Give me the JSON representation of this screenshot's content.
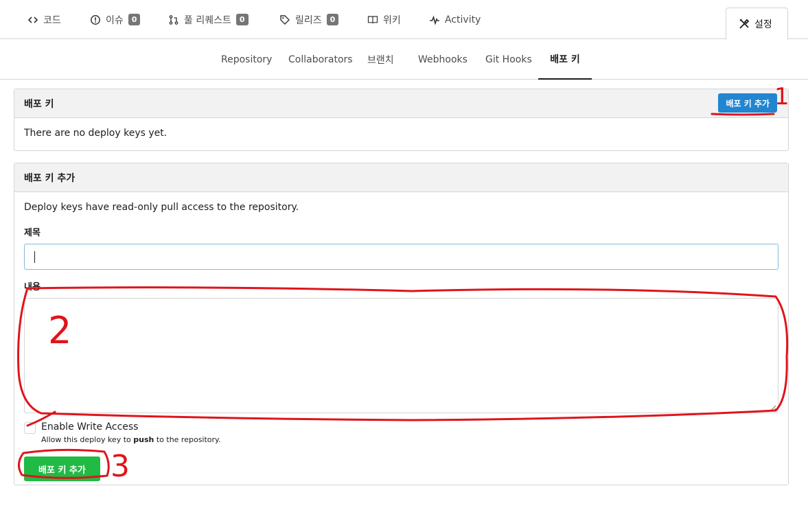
{
  "repo_tabs": [
    {
      "label": "코드",
      "icon": "code-icon"
    },
    {
      "label": "이슈",
      "icon": "issue-icon",
      "count": "0"
    },
    {
      "label": "풀 리퀘스트",
      "icon": "pull-request-icon",
      "count": "0"
    },
    {
      "label": "릴리즈",
      "icon": "tag-icon",
      "count": "0"
    },
    {
      "label": "위키",
      "icon": "book-icon"
    },
    {
      "label": "Activity",
      "icon": "pulse-icon"
    },
    {
      "label": "설정",
      "icon": "tools-icon",
      "active": true
    }
  ],
  "settings_nav": [
    {
      "label": "Repository"
    },
    {
      "label": "Collaborators"
    },
    {
      "label": "브랜치"
    },
    {
      "label": "Webhooks"
    },
    {
      "label": "Git Hooks"
    },
    {
      "label": "배포 키",
      "active": true
    }
  ],
  "deploy_keys": {
    "title": "배포 키",
    "add_button": "배포 키 추가",
    "empty_text": "There are no deploy keys yet."
  },
  "add_form": {
    "title": "배포 키 추가",
    "description": "Deploy keys have read-only pull access to the repository.",
    "title_label": "제목",
    "title_value": "",
    "content_label": "내용",
    "content_value": "",
    "write_access_label": "Enable Write Access",
    "write_access_help_prefix": "Allow this deploy key to",
    "write_access_help_bold": "push",
    "write_access_help_suffix": "to the repository.",
    "write_access_checked": false,
    "submit_label": "배포 키 추가"
  },
  "annotations": [
    "1",
    "2",
    "3"
  ],
  "colors": {
    "primary_blue": "#2185d0",
    "success_green": "#21ba45",
    "annotation_red": "#e0141b"
  }
}
